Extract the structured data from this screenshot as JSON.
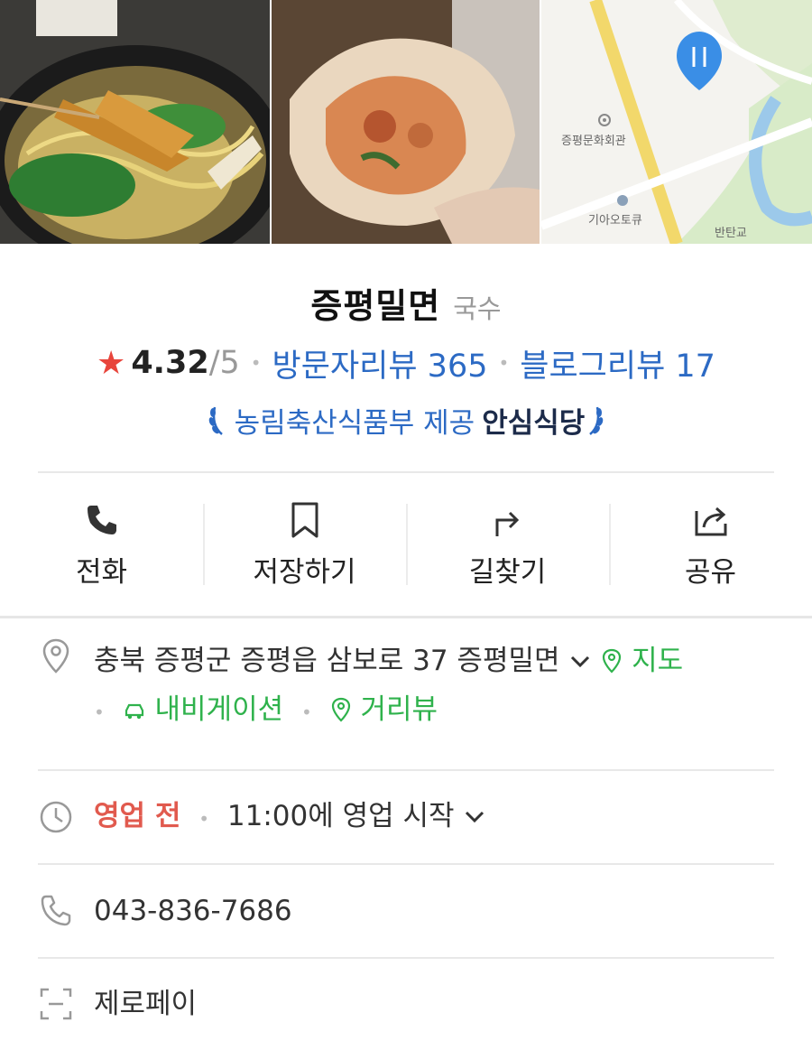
{
  "photos": {
    "map_labels": [
      "증평문화회관",
      "기아오토큐",
      "반탄교"
    ],
    "marker": "restaurant-marker-icon"
  },
  "place": {
    "name": "증평밀면",
    "category": "국수",
    "rating_score": "4.32",
    "rating_outof": "/5",
    "visitor_reviews": "방문자리뷰 365",
    "blog_reviews": "블로그리뷰 17",
    "badge_text": "농림축산식품부 제공",
    "badge_strong": "안심식당"
  },
  "actions": [
    {
      "label": "전화",
      "icon": "phone-icon"
    },
    {
      "label": "저장하기",
      "icon": "bookmark-icon"
    },
    {
      "label": "길찾기",
      "icon": "directions-icon"
    },
    {
      "label": "공유",
      "icon": "share-icon"
    }
  ],
  "details": {
    "address": "충북 증평군 증평읍 삼보로 37 증평밀면",
    "map_link": "지도",
    "navigation_link": "내비게이션",
    "streetview_link": "거리뷰",
    "status": "영업 전",
    "hours": "11:00에 영업 시작",
    "phone": "043-836-7686",
    "payment": "제로페이"
  },
  "colors": {
    "link_blue": "#2c6ac4",
    "accent_green": "#2fb24c",
    "status_red": "#e15a4e",
    "star_red": "#e8453c"
  }
}
